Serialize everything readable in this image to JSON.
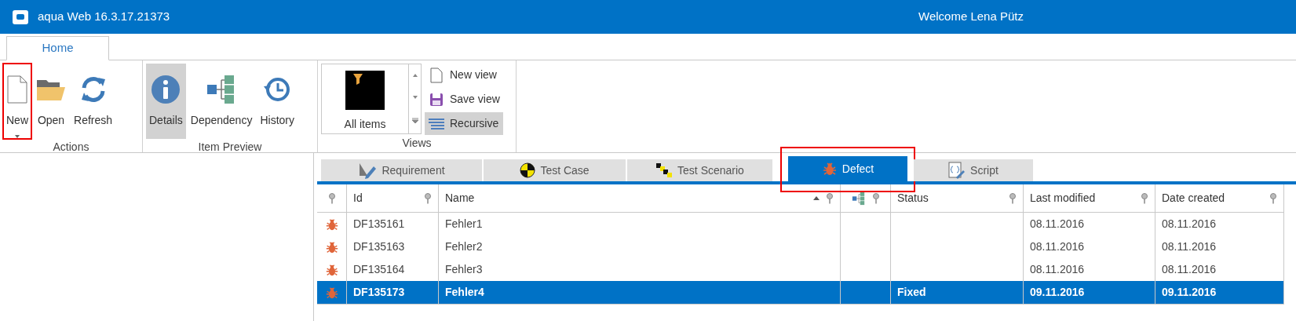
{
  "window": {
    "title": "aqua Web 16.3.17.21373",
    "welcome": "Welcome Lena Pütz"
  },
  "ribbon_tabs": [
    {
      "label": "Home",
      "selected": true
    }
  ],
  "ribbon_groups": [
    {
      "kind": "large",
      "label": "Actions",
      "items": [
        {
          "kind": "new",
          "label": "New",
          "selected": false,
          "highlighted": true,
          "dropdown": true
        },
        {
          "kind": "open",
          "label": "Open",
          "selected": false,
          "highlighted": false,
          "dropdown": false
        },
        {
          "kind": "refresh",
          "label": "Refresh",
          "selected": false,
          "highlighted": false,
          "dropdown": false
        }
      ]
    },
    {
      "kind": "large",
      "label": "Item Preview",
      "items": [
        {
          "kind": "details",
          "label": "Details",
          "selected": true,
          "highlighted": false,
          "dropdown": false
        },
        {
          "kind": "dependency",
          "label": "Dependency",
          "selected": false,
          "highlighted": false,
          "dropdown": false
        },
        {
          "kind": "history",
          "label": "History",
          "selected": false,
          "highlighted": false,
          "dropdown": false
        }
      ]
    },
    {
      "kind": "views",
      "label": "Views",
      "gallery": {
        "label": "All items"
      },
      "items": [
        {
          "kind": "new-view",
          "label": "New view",
          "selected": false
        },
        {
          "kind": "save-view",
          "label": "Save view",
          "selected": false
        },
        {
          "kind": "recursive",
          "label": "Recursive",
          "selected": true
        }
      ]
    }
  ],
  "item_tabs": [
    {
      "kind": "requirement",
      "label": "Requirement",
      "selected": false,
      "highlighted": false
    },
    {
      "kind": "test-case",
      "label": "Test Case",
      "selected": false,
      "highlighted": false
    },
    {
      "kind": "test-scenario",
      "label": "Test Scenario",
      "selected": false,
      "highlighted": false
    },
    {
      "kind": "defect",
      "label": "Defect",
      "selected": true,
      "highlighted": true
    },
    {
      "kind": "script",
      "label": "Script",
      "selected": false,
      "highlighted": false
    }
  ],
  "table": {
    "columns": [
      {
        "kind": "icon",
        "sorted": false
      },
      {
        "kind": "text",
        "label": "Id",
        "sorted": false
      },
      {
        "kind": "text",
        "label": "Name",
        "sorted": true
      },
      {
        "kind": "dependency",
        "sorted": false
      },
      {
        "kind": "text",
        "label": "Status",
        "sorted": false
      },
      {
        "kind": "text",
        "label": "Last modified",
        "sorted": false
      },
      {
        "kind": "text",
        "label": "Date created",
        "sorted": false
      }
    ],
    "rows": [
      {
        "id": "DF135161",
        "name": "Fehler1",
        "last_modified": "08.11.2016",
        "date_created": "08.11.2016",
        "selected": false
      },
      {
        "id": "DF135163",
        "name": "Fehler2",
        "last_modified": "08.11.2016",
        "date_created": "08.11.2016",
        "selected": false
      },
      {
        "id": "DF135164",
        "name": "Fehler3",
        "last_modified": "08.11.2016",
        "date_created": "08.11.2016",
        "selected": false
      },
      {
        "id": "DF135173",
        "name": "Fehler4",
        "status": "Fixed",
        "last_modified": "09.11.2016",
        "date_created": "09.11.2016",
        "selected": true
      }
    ]
  }
}
